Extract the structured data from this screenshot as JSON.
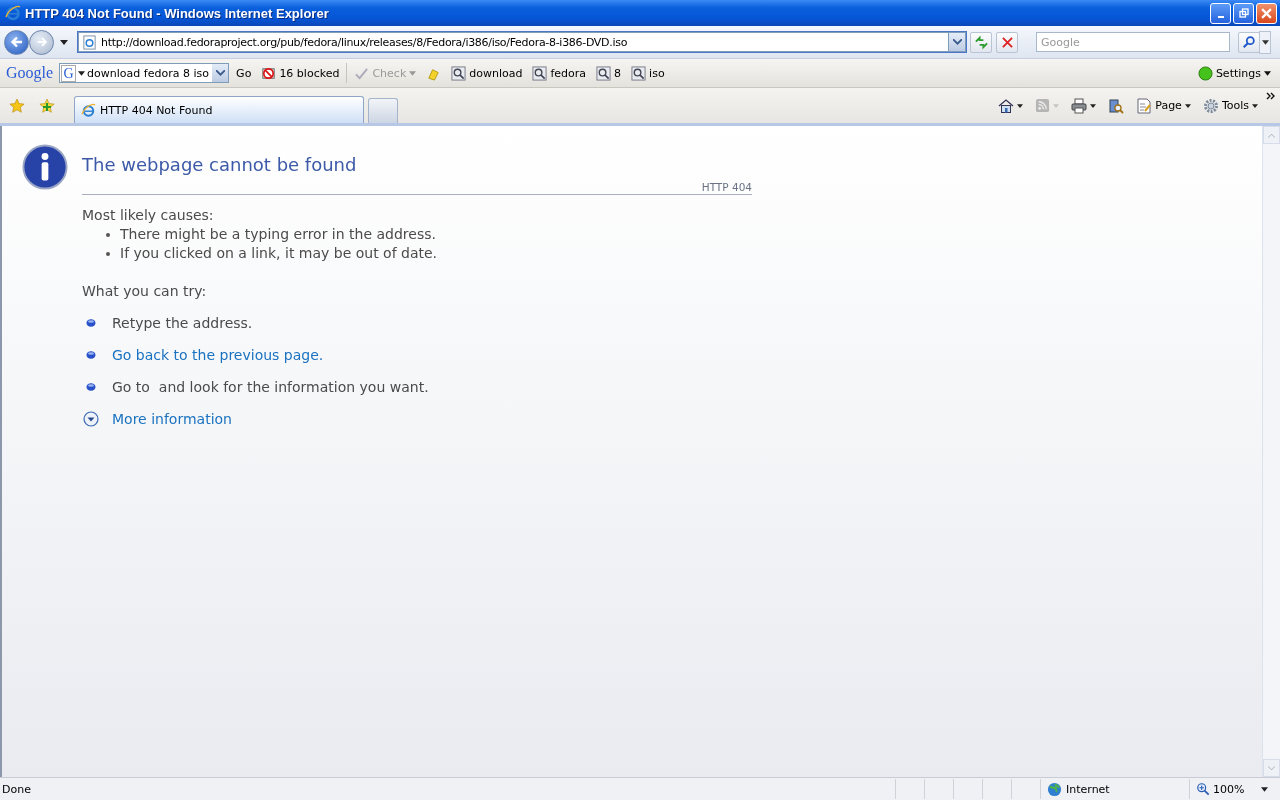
{
  "window": {
    "title": "HTTP 404 Not Found - Windows Internet Explorer"
  },
  "navigation": {
    "address": "http://download.fedoraproject.org/pub/fedora/linux/releases/8/Fedora/i386/iso/Fedora-8-i386-DVD.iso",
    "search_placeholder": "Google"
  },
  "google_toolbar": {
    "logo": "Google",
    "engine_icon": "G",
    "query": "download fedora 8 iso",
    "go": "Go",
    "popups": "16 blocked",
    "check": "Check",
    "search_terms": [
      "download",
      "fedora",
      "8",
      "iso"
    ],
    "settings": "Settings"
  },
  "tabs": [
    {
      "label": "HTTP 404 Not Found",
      "selected": true
    }
  ],
  "command_bar": {
    "page": "Page",
    "tools": "Tools"
  },
  "content": {
    "heading": "The webpage cannot be found",
    "code": "HTTP 404",
    "causes_title": "Most likely causes:",
    "causes": [
      "There might be a typing error in the address.",
      "If you clicked on a link, it may be out of date."
    ],
    "try_title": "What you can try:",
    "try": [
      {
        "kind": "text",
        "text": "Retype the address."
      },
      {
        "kind": "link",
        "text": "Go back to the previous page."
      },
      {
        "kind": "text",
        "text": "Go to  and look for the information you want."
      }
    ],
    "more_info": "More information"
  },
  "status_bar": {
    "status": "Done",
    "zone": "Internet",
    "zoom": "100%"
  }
}
